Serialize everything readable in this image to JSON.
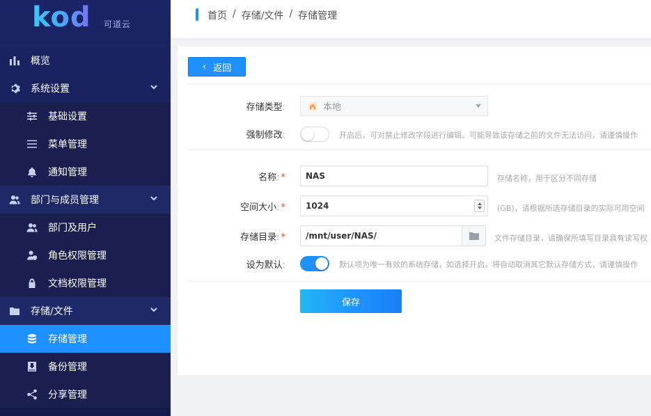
{
  "logo": {
    "mark": "kod",
    "sub": "可道云"
  },
  "sidebar": {
    "items": [
      {
        "label": "概览",
        "icon": "bar-chart-icon"
      },
      {
        "label": "系统设置",
        "icon": "gear-icon"
      },
      {
        "label": "基础设置",
        "icon": "sliders-icon"
      },
      {
        "label": "菜单管理",
        "icon": "menu-icon"
      },
      {
        "label": "通知管理",
        "icon": "bell-icon"
      },
      {
        "label": "部门与成员管理",
        "icon": "users-icon"
      },
      {
        "label": "部门及用户",
        "icon": "users-icon"
      },
      {
        "label": "角色权限管理",
        "icon": "user-shield-icon"
      },
      {
        "label": "文档权限管理",
        "icon": "lock-icon"
      },
      {
        "label": "存储/文件",
        "icon": "folder-icon"
      },
      {
        "label": "存储管理",
        "icon": "database-icon"
      },
      {
        "label": "备份管理",
        "icon": "backup-icon"
      },
      {
        "label": "分享管理",
        "icon": "share-icon"
      }
    ]
  },
  "breadcrumb": {
    "home": "首页",
    "section": "存储/文件",
    "current": "存储管理",
    "sep": "/"
  },
  "form": {
    "back_label": "返回",
    "storage_type_label": "存储类型",
    "storage_type_value": "本地",
    "force_edit_label": "强制修改",
    "force_edit_hint": "开启后，可对禁止修改字段进行编辑。可能导致该存储之前的文件无法访问，请谨慎操作",
    "name_label": "名称",
    "name_value": "NAS",
    "name_hint": "存储名称，用于区分不同存储",
    "size_label": "空间大小",
    "size_value": "1024",
    "size_hint": "(GB)，请根据所选存储目录的实际可用空间",
    "dir_label": "存储目录",
    "dir_value": "/mnt/user/NAS/",
    "dir_hint": "文件存储目录，请确保所填写目录具有读写权",
    "default_label": "设为默认",
    "default_hint": "默认项为唯一有效的系统存储，如选择开启，将自动取消其它默认存储方式，请谨慎操作",
    "save_label": "保存",
    "required_mark": "*",
    "colon": ":"
  },
  "colors": {
    "accent": "#1e90ff",
    "sidebar_bg": "#1b2466",
    "required": "#ef4a23"
  }
}
